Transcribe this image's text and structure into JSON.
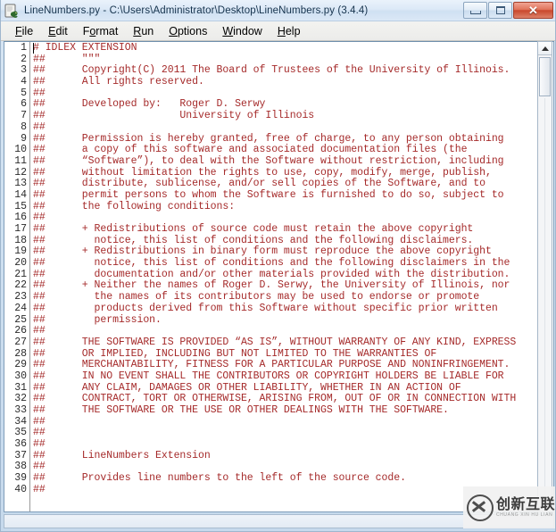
{
  "window": {
    "title": "LineNumbers.py - C:\\Users\\Administrator\\Desktop\\LineNumbers.py (3.4.4)",
    "app_icon": "python-idle-icon",
    "controls": {
      "minimize": "–",
      "maximize": "□",
      "close": "✕"
    }
  },
  "menubar": {
    "items": [
      {
        "label": "File",
        "mnemonic": "F",
        "rest": "ile"
      },
      {
        "label": "Edit",
        "mnemonic": "E",
        "rest": "dit"
      },
      {
        "label": "Format",
        "mnemonic": "o",
        "pre": "F",
        "rest": "rmat"
      },
      {
        "label": "Run",
        "mnemonic": "R",
        "rest": "un"
      },
      {
        "label": "Options",
        "mnemonic": "O",
        "rest": "ptions"
      },
      {
        "label": "Window",
        "mnemonic": "W",
        "rest": "indow"
      },
      {
        "label": "Help",
        "mnemonic": "H",
        "rest": "elp"
      }
    ]
  },
  "editor": {
    "language": "python",
    "comment_color": "#a52a2a",
    "line_number_color": "#2b2b2b",
    "background": "#ffffff",
    "first_visible_line": 1,
    "last_visible_line": 40,
    "caret_line": 1,
    "caret_column": 1,
    "lines": [
      {
        "n": "1",
        "text": "# IDLEX EXTENSION"
      },
      {
        "n": "2",
        "text": "##      \"\"\""
      },
      {
        "n": "3",
        "text": "##      Copyright(C) 2011 The Board of Trustees of the University of Illinois."
      },
      {
        "n": "4",
        "text": "##      All rights reserved."
      },
      {
        "n": "5",
        "text": "##"
      },
      {
        "n": "6",
        "text": "##      Developed by:   Roger D. Serwy"
      },
      {
        "n": "7",
        "text": "##                      University of Illinois"
      },
      {
        "n": "8",
        "text": "##"
      },
      {
        "n": "9",
        "text": "##      Permission is hereby granted, free of charge, to any person obtaining"
      },
      {
        "n": "10",
        "text": "##      a copy of this software and associated documentation files (the"
      },
      {
        "n": "11",
        "text": "##      “Software”), to deal with the Software without restriction, including"
      },
      {
        "n": "12",
        "text": "##      without limitation the rights to use, copy, modify, merge, publish,"
      },
      {
        "n": "13",
        "text": "##      distribute, sublicense, and/or sell copies of the Software, and to"
      },
      {
        "n": "14",
        "text": "##      permit persons to whom the Software is furnished to do so, subject to"
      },
      {
        "n": "15",
        "text": "##      the following conditions:"
      },
      {
        "n": "16",
        "text": "##"
      },
      {
        "n": "17",
        "text": "##      + Redistributions of source code must retain the above copyright"
      },
      {
        "n": "18",
        "text": "##        notice, this list of conditions and the following disclaimers."
      },
      {
        "n": "19",
        "text": "##      + Redistributions in binary form must reproduce the above copyright"
      },
      {
        "n": "20",
        "text": "##        notice, this list of conditions and the following disclaimers in the"
      },
      {
        "n": "21",
        "text": "##        documentation and/or other materials provided with the distribution."
      },
      {
        "n": "22",
        "text": "##      + Neither the names of Roger D. Serwy, the University of Illinois, nor"
      },
      {
        "n": "23",
        "text": "##        the names of its contributors may be used to endorse or promote"
      },
      {
        "n": "24",
        "text": "##        products derived from this Software without specific prior written"
      },
      {
        "n": "25",
        "text": "##        permission."
      },
      {
        "n": "26",
        "text": "##"
      },
      {
        "n": "27",
        "text": "##      THE SOFTWARE IS PROVIDED “AS IS”, WITHOUT WARRANTY OF ANY KIND, EXPRESS"
      },
      {
        "n": "28",
        "text": "##      OR IMPLIED, INCLUDING BUT NOT LIMITED TO THE WARRANTIES OF"
      },
      {
        "n": "29",
        "text": "##      MERCHANTABILITY, FITNESS FOR A PARTICULAR PURPOSE AND NONINFRINGEMENT."
      },
      {
        "n": "30",
        "text": "##      IN NO EVENT SHALL THE CONTRIBUTORS OR COPYRIGHT HOLDERS BE LIABLE FOR"
      },
      {
        "n": "31",
        "text": "##      ANY CLAIM, DAMAGES OR OTHER LIABILITY, WHETHER IN AN ACTION OF"
      },
      {
        "n": "32",
        "text": "##      CONTRACT, TORT OR OTHERWISE, ARISING FROM, OUT OF OR IN CONNECTION WITH"
      },
      {
        "n": "33",
        "text": "##      THE SOFTWARE OR THE USE OR OTHER DEALINGS WITH THE SOFTWARE."
      },
      {
        "n": "34",
        "text": "##"
      },
      {
        "n": "35",
        "text": "##"
      },
      {
        "n": "36",
        "text": "##"
      },
      {
        "n": "37",
        "text": "##      LineNumbers Extension"
      },
      {
        "n": "38",
        "text": "##"
      },
      {
        "n": "39",
        "text": "##      Provides line numbers to the left of the source code."
      },
      {
        "n": "40",
        "text": "##"
      }
    ]
  },
  "scrollbar": {
    "up_arrow": "▲",
    "orientation": "vertical"
  },
  "watermark": {
    "chinese": "创新互联",
    "pinyin": "CHUANG XIN HU LIAN",
    "logo": "circled-x-logo"
  }
}
